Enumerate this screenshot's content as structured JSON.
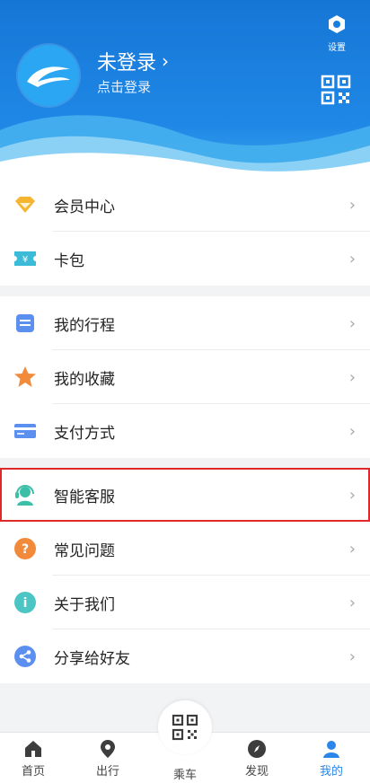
{
  "header": {
    "login_name": "未登录",
    "login_hint": "点击登录",
    "settings_label": "设置"
  },
  "menu": {
    "group1": [
      {
        "label": "会员中心",
        "icon": "diamond-icon"
      },
      {
        "label": "卡包",
        "icon": "ticket-icon"
      }
    ],
    "group2": [
      {
        "label": "我的行程",
        "icon": "itinerary-icon"
      },
      {
        "label": "我的收藏",
        "icon": "star-icon"
      },
      {
        "label": "支付方式",
        "icon": "card-icon"
      }
    ],
    "group3": [
      {
        "label": "智能客服",
        "icon": "headset-icon"
      },
      {
        "label": "常见问题",
        "icon": "question-icon"
      },
      {
        "label": "关于我们",
        "icon": "info-icon"
      },
      {
        "label": "分享给好友",
        "icon": "share-icon"
      }
    ]
  },
  "tabbar": {
    "tabs": [
      {
        "label": "首页",
        "icon": "home-icon"
      },
      {
        "label": "出行",
        "icon": "location-icon"
      },
      {
        "label": "乘车",
        "icon": "qr-code-icon"
      },
      {
        "label": "发现",
        "icon": "compass-icon"
      },
      {
        "label": "我的",
        "icon": "user-icon"
      }
    ],
    "active_index": 4
  },
  "colors": {
    "header_blue": "#1f88e6",
    "highlight_border": "#e02a2a",
    "active_tab": "#2a86e8"
  }
}
